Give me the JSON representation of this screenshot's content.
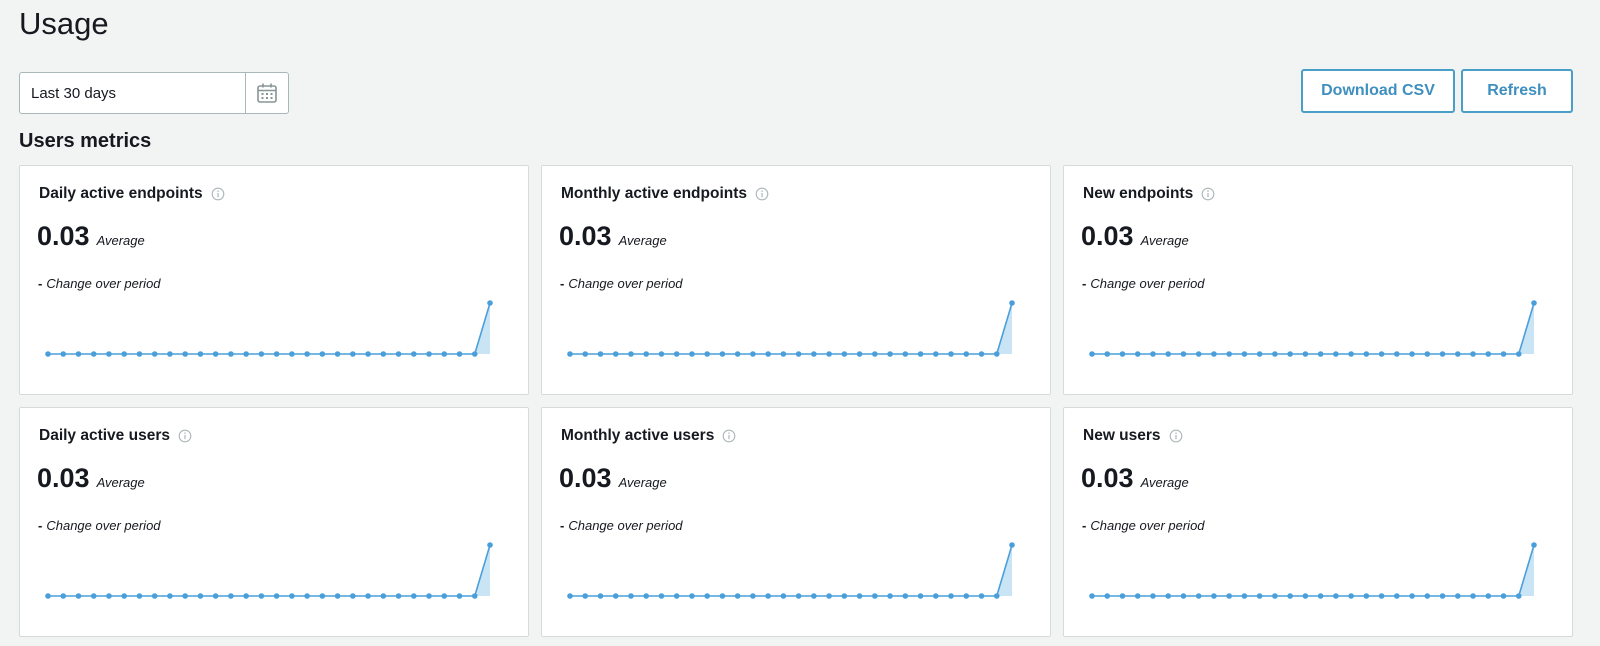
{
  "page": {
    "title": "Usage"
  },
  "date_range": {
    "value": "Last 30 days",
    "icon": "calendar-icon"
  },
  "actions": {
    "download_label": "Download CSV",
    "refresh_label": "Refresh"
  },
  "section": {
    "title": "Users metrics"
  },
  "colors": {
    "accent": "#4a9fc8",
    "line": "#4a9fdb",
    "area": "#c9e4f5"
  },
  "cards": [
    {
      "title": "Daily active endpoints",
      "value": "0.03",
      "value_label": "Average",
      "change_symbol": "-",
      "change_label": "Change over period"
    },
    {
      "title": "Monthly active endpoints",
      "value": "0.03",
      "value_label": "Average",
      "change_symbol": "-",
      "change_label": "Change over period"
    },
    {
      "title": "New endpoints",
      "value": "0.03",
      "value_label": "Average",
      "change_symbol": "-",
      "change_label": "Change over period"
    },
    {
      "title": "Daily active users",
      "value": "0.03",
      "value_label": "Average",
      "change_symbol": "-",
      "change_label": "Change over period"
    },
    {
      "title": "Monthly active users",
      "value": "0.03",
      "value_label": "Average",
      "change_symbol": "-",
      "change_label": "Change over period"
    },
    {
      "title": "New users",
      "value": "0.03",
      "value_label": "Average",
      "change_symbol": "-",
      "change_label": "Change over period"
    }
  ],
  "sparkline": {
    "values": [
      0,
      0,
      0,
      0,
      0,
      0,
      0,
      0,
      0,
      0,
      0,
      0,
      0,
      0,
      0,
      0,
      0,
      0,
      0,
      0,
      0,
      0,
      0,
      0,
      0,
      0,
      0,
      0,
      0,
      1
    ]
  }
}
